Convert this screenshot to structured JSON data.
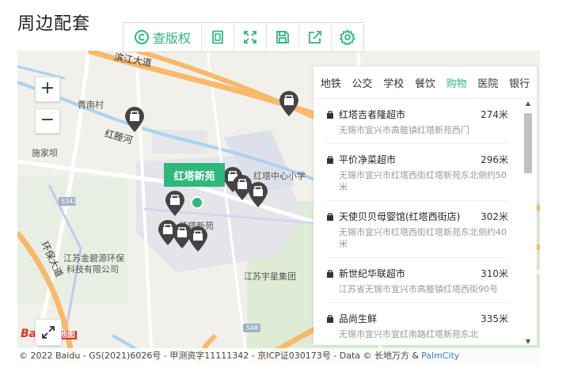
{
  "section_title": "周边配套",
  "toolbar": {
    "copyright_label": "查版权",
    "icons": [
      "copyright-icon",
      "page-icon",
      "expand-icon",
      "save-icon",
      "share-icon",
      "settings-icon"
    ]
  },
  "map": {
    "zoom_in": "+",
    "zoom_out": "−",
    "road_labels": [
      "滨江大道",
      "红塍河",
      "环保大道"
    ],
    "place_labels": [
      "曹南村",
      "施家坝",
      "红塔中心小学",
      "江苏金碧源环保",
      "科技有限公司",
      "江苏宇星集团",
      "红塔新苑"
    ],
    "road_numbers": [
      "S342",
      "S48"
    ],
    "selected_label": "红塔新苑",
    "logo_text": "Bai",
    "logo_suffix": "地图",
    "footer_text": "© 2022 Baidu - GS(2021)6026号 - 甲测资字11111342 - 京ICP证030173号 - Data © 长地万方 &",
    "footer_link": "PalmCity"
  },
  "panel": {
    "tabs": [
      "地铁",
      "公交",
      "学校",
      "餐饮",
      "购物",
      "医院",
      "银行"
    ],
    "active_tab": "购物",
    "items": [
      {
        "name": "红塔吉者隆超市",
        "distance": "274米",
        "address": "无锡市宜兴市高塍镇红塔新苑西门"
      },
      {
        "name": "平价净菜超市",
        "distance": "296米",
        "address": "无锡市宜兴市红塔西街红塔新苑东北侧约50米"
      },
      {
        "name": "天使贝贝母婴馆(红塔西街店)",
        "distance": "302米",
        "address": "无锡市宜兴市红塔西街红塔新苑东北侧约40米"
      },
      {
        "name": "新世纪华联超市",
        "distance": "310米",
        "address": "江苏省无锡市宜兴市高塍镇红塔西街90号"
      },
      {
        "name": "品尚生鲜",
        "distance": "335米",
        "address": "无锡市宜兴市宜红南路红塔新苑东北"
      }
    ]
  },
  "colors": {
    "accent": "#2db87d",
    "road_orange": "#f7b96b",
    "water": "#a9d3f2"
  }
}
